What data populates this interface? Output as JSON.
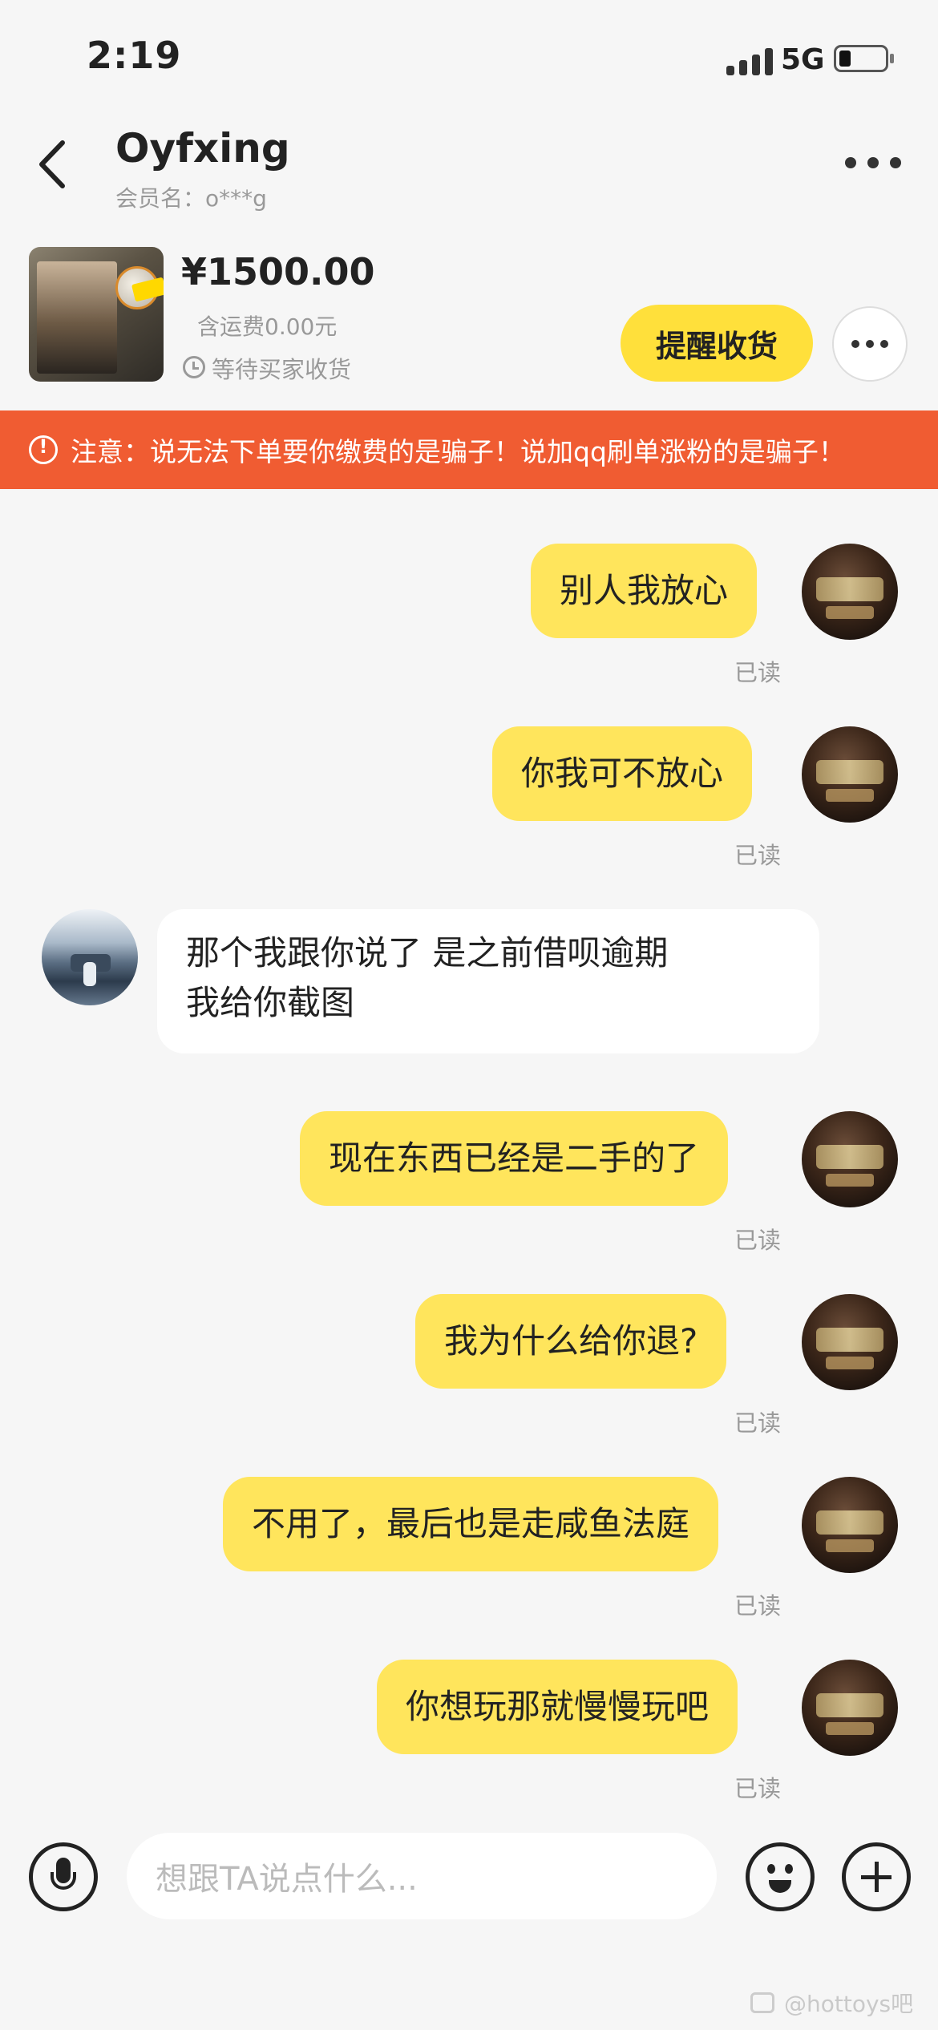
{
  "status_bar": {
    "time": "2:19",
    "network": "5G"
  },
  "header": {
    "contact_name": "Oyfxing",
    "member_name": "会员名：o***g"
  },
  "product": {
    "price": "¥1500.00",
    "shipping": "含运费0.00元",
    "status": "等待买家收货",
    "remind_label": "提醒收货"
  },
  "warning": {
    "text": "注意：说无法下单要你缴费的是骗子！说加qq刷单涨粉的是骗子！"
  },
  "messages": [
    {
      "side": "mine",
      "text": "别人我放心",
      "read": "已读"
    },
    {
      "side": "mine",
      "text": "你我可不放心",
      "read": "已读"
    },
    {
      "side": "theirs",
      "line1": "那个我跟你说了  是之前借呗逾期",
      "line2": "我给你截图"
    },
    {
      "side": "mine",
      "text": "现在东西已经是二手的了",
      "read": "已读"
    },
    {
      "side": "mine",
      "text": "我为什么给你退?",
      "read": "已读"
    },
    {
      "side": "mine",
      "text": "不用了，最后也是走咸鱼法庭",
      "read": "已读"
    },
    {
      "side": "mine",
      "text": "你想玩那就慢慢玩吧",
      "read": "已读"
    }
  ],
  "input": {
    "placeholder": "想跟TA说点什么..."
  },
  "watermark": {
    "text": "@hottoys吧"
  },
  "colors": {
    "accent": "#ffe03b",
    "bubble_mine": "#ffe55c",
    "warning": "#f05c32",
    "background": "#f6f6f6"
  },
  "icons": [
    "back-icon",
    "more-icon",
    "clock-icon",
    "alert-icon",
    "mic-icon",
    "emoji-icon",
    "add-icon"
  ]
}
